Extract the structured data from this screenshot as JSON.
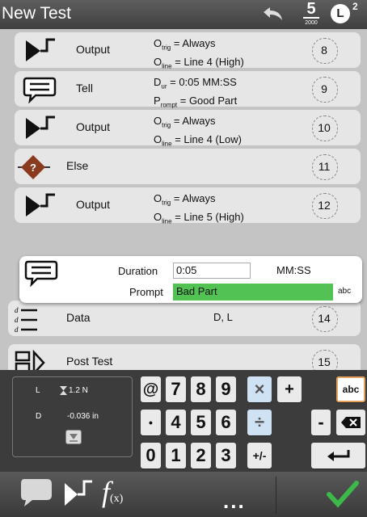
{
  "header": {
    "title": "New Test",
    "speed_value": "5",
    "speed_sub": "2000",
    "badge": "L",
    "badge_sup": "2"
  },
  "rows": [
    {
      "label": "Output",
      "line1_main": "O",
      "line1_sub": "trig",
      "line1_rest": " = Always",
      "line2_main": "O",
      "line2_sub": "line",
      "line2_rest": " = Line 4 (High)",
      "num": "8"
    },
    {
      "label": "Tell",
      "line1_main": "D",
      "line1_sub": "ur",
      "line1_rest": " = 0:05 MM:SS",
      "line2_main": "P",
      "line2_sub": "rompt",
      "line2_rest": " = Good Part",
      "num": "9"
    },
    {
      "label": "Output",
      "line1_main": "O",
      "line1_sub": "trig",
      "line1_rest": " = Always",
      "line2_main": "O",
      "line2_sub": "line",
      "line2_rest": " = Line 4 (Low)",
      "num": "10"
    },
    {
      "label": "Else",
      "num": "11"
    },
    {
      "label": "Output",
      "line1_main": "O",
      "line1_sub": "trig",
      "line1_rest": " = Always",
      "line2_main": "O",
      "line2_sub": "line",
      "line2_rest": " = Line 5 (High)",
      "num": "12"
    },
    {
      "label": "Data",
      "value": "D, L",
      "num": "14"
    },
    {
      "label": "Post Test",
      "num": "15"
    }
  ],
  "popup": {
    "duration_label": "Duration",
    "duration_value": "0:05",
    "duration_unit": "MM:SS",
    "prompt_label": "Prompt",
    "prompt_value": "Bad Part",
    "keyboard_hint": "abc"
  },
  "status": {
    "l_label": "L",
    "l_value": "1.2 N",
    "d_label": "D",
    "d_value": "-0.036 in"
  },
  "keys": {
    "at": "@",
    "k7": "7",
    "k8": "8",
    "k9": "9",
    "times": "×",
    "plus": "+",
    "abc": "abc",
    "dot": "•",
    "k4": "4",
    "k5": "5",
    "k6": "6",
    "divide": "÷",
    "minus": "-",
    "k0": "0",
    "k1": "1",
    "k2": "2",
    "k3": "3",
    "plusminus": "+/-"
  },
  "bottom": {
    "fx_label": "f",
    "fx_sub": "(x)",
    "more": "..."
  }
}
